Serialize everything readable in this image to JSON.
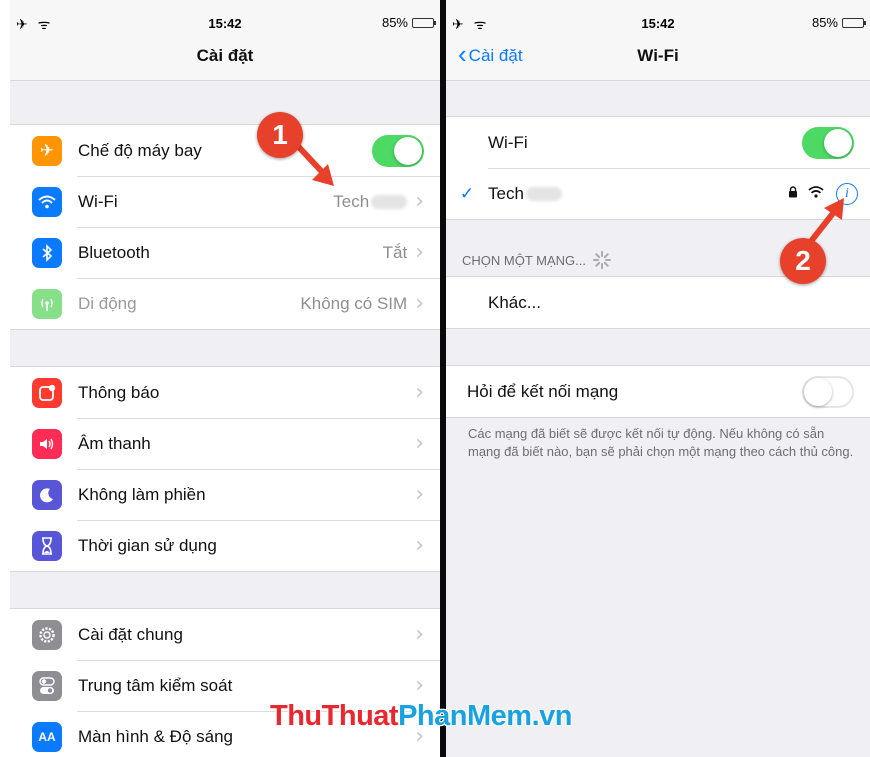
{
  "status_bar": {
    "time": "15:42",
    "battery": "85%",
    "left_glyphs": "✈ ᯤ"
  },
  "left": {
    "title": "Cài đặt",
    "group1": [
      {
        "label": "Chế độ máy bay",
        "icon": "airplane-icon",
        "color": "#ff9500",
        "toggle": "on"
      },
      {
        "label": "Wi-Fi",
        "icon": "wifi-icon",
        "color": "#0a7aff",
        "value": "Tech"
      },
      {
        "label": "Bluetooth",
        "icon": "bluetooth-icon",
        "color": "#0a7aff",
        "value": "Tắt"
      },
      {
        "label": "Di động",
        "icon": "antenna-icon",
        "color": "#86e08a",
        "value": "Không có SIM"
      }
    ],
    "group2": [
      {
        "label": "Thông báo",
        "icon": "notification-icon",
        "color": "#ff3b30"
      },
      {
        "label": "Âm thanh",
        "icon": "speaker-icon",
        "color": "#ff2d55"
      },
      {
        "label": "Không làm phiền",
        "icon": "moon-icon",
        "color": "#5856d6"
      },
      {
        "label": "Thời gian sử dụng",
        "icon": "hourglass-icon",
        "color": "#5856d6"
      }
    ],
    "group3": [
      {
        "label": "Cài đặt chung",
        "icon": "gear-icon",
        "color": "#8e8e93"
      },
      {
        "label": "Trung tâm kiểm soát",
        "icon": "switches-icon",
        "color": "#8e8e93"
      },
      {
        "label": "Màn hình & Độ sáng",
        "icon": "text-size-icon",
        "color": "#0a7aff"
      }
    ]
  },
  "right": {
    "back_label": "Cài đặt",
    "title": "Wi-Fi",
    "wifi_row": {
      "label": "Wi-Fi",
      "toggle": "on"
    },
    "connected_network": "Tech",
    "choose_header": "CHỌN MỘT MẠNG...",
    "other_label": "Khác...",
    "ask_join": {
      "label": "Hỏi để kết nối mạng",
      "toggle": "off"
    },
    "ask_join_note": "Các mạng đã biết sẽ được kết nối tự động. Nếu không có sẵn mạng đã biết nào, bạn sẽ phải chọn một mạng theo cách thủ công."
  },
  "annotations": {
    "marker1": "1",
    "marker2": "2"
  },
  "watermark": {
    "part1": "ThuThuat",
    "part2": "PhanMem",
    "part3": ".vn"
  },
  "colors": {
    "accent": "#0a7aff",
    "toggle_on": "#4cd964",
    "marker": "#e8412b",
    "wm_red": "#e8282e",
    "wm_blue": "#1aa1e0"
  }
}
